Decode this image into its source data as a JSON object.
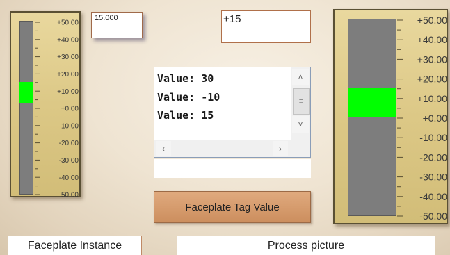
{
  "left_gauge": {
    "scale_labels": [
      "+50.00",
      "+40.00",
      "+30.00",
      "+20.00",
      "+10.00",
      "+0.00",
      "-10.00",
      "-20.00",
      "-30.00",
      "-40.00",
      "-50.00"
    ],
    "fill_range": [
      3,
      15
    ],
    "range": [
      -50,
      50
    ],
    "fill_color": "#00ff00",
    "track_color": "#7d7d7d"
  },
  "right_gauge": {
    "scale_labels": [
      "+50.00",
      "+40.00",
      "+30.00",
      "+20.00",
      "+10.00",
      "+0.00",
      "-10.00",
      "-20.00",
      "-30.00",
      "-40.00",
      "-50.00"
    ],
    "fill_range": [
      0,
      15
    ],
    "range": [
      -50,
      50
    ],
    "fill_color": "#00ff00",
    "track_color": "#7d7d7d"
  },
  "small_value_box": {
    "text": "15.000"
  },
  "top_value_box": {
    "text": "+15"
  },
  "value_list": {
    "items": [
      "Value: 30",
      "Value: -10",
      "Value: 15"
    ]
  },
  "empty_field": {
    "text": ""
  },
  "faceplate_button": {
    "label": "Faceplate Tag Value"
  },
  "tabs": {
    "faceplate_instance": "Faceplate Instance",
    "process_picture": "Process picture"
  },
  "icons": {
    "scroll_up": "chevron-up-icon",
    "scroll_down": "chevron-down-icon",
    "scroll_left": "chevron-left-icon",
    "scroll_right": "chevron-right-icon",
    "thumb_grip": "grip-icon"
  }
}
